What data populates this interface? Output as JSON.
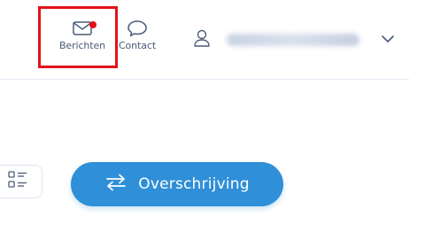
{
  "header": {
    "nav": [
      {
        "label": "Berichten",
        "icon": "envelope-icon",
        "has_notification": true
      },
      {
        "label": "Contact",
        "icon": "speech-bubble-icon"
      }
    ],
    "user": {
      "icon": "user-icon",
      "name_blurred": true
    },
    "menu_icon": "chevron-down-icon"
  },
  "actions": {
    "view_toggle_icon": "list-view-icon",
    "transfer_button": {
      "label": "Overschrijving",
      "icon": "transfer-arrows-icon"
    }
  },
  "colors": {
    "accent": "#2f8fd8",
    "notification": "#e0101a",
    "highlight": "#e4121b",
    "text": "#4a5a78"
  }
}
